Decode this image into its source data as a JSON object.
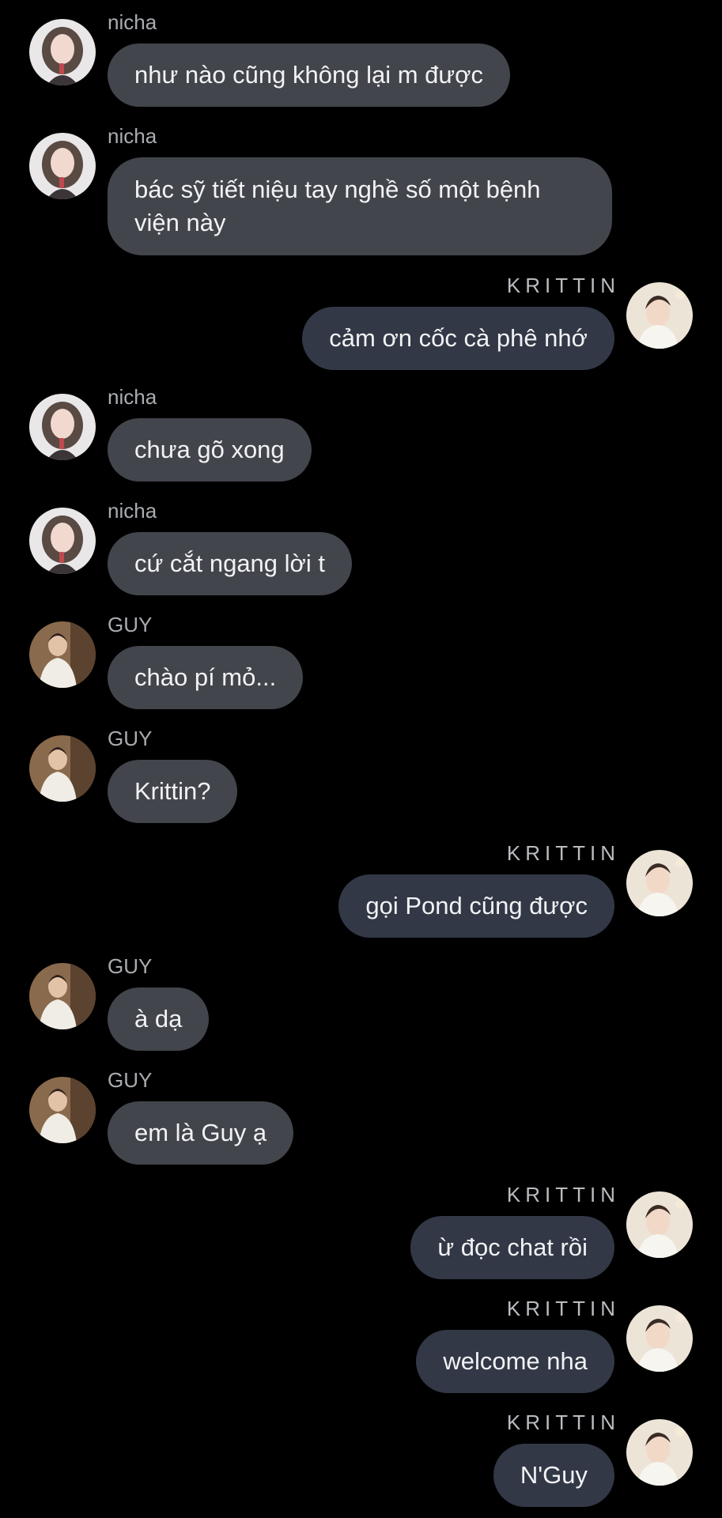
{
  "colors": {
    "background": "#000000",
    "incoming_bubble": "#43454c",
    "outgoing_bubble": "#323846",
    "bubble_text": "#f1f2f4",
    "incoming_name": "#a9acb1",
    "outgoing_name": "#b9bcc1"
  },
  "messages": [
    {
      "sender": "nicha",
      "side": "left",
      "avatar": "nicha-avatar",
      "text": "như nào cũng không lại m được"
    },
    {
      "sender": "nicha",
      "side": "left",
      "avatar": "nicha-avatar",
      "text": "bác sỹ tiết niệu tay nghề số một bệnh viện này"
    },
    {
      "sender": "KRITTIN",
      "side": "right",
      "avatar": "krittin-avatar",
      "text": "cảm ơn cốc cà phê nhớ"
    },
    {
      "sender": "nicha",
      "side": "left",
      "avatar": "nicha-avatar",
      "text": "chưa gõ xong"
    },
    {
      "sender": "nicha",
      "side": "left",
      "avatar": "nicha-avatar",
      "text": "cứ cắt ngang lời t"
    },
    {
      "sender": "GUY",
      "side": "left",
      "avatar": "guy-avatar",
      "text": "chào pí mỏ..."
    },
    {
      "sender": "GUY",
      "side": "left",
      "avatar": "guy-avatar",
      "text": "Krittin?"
    },
    {
      "sender": "KRITTIN",
      "side": "right",
      "avatar": "krittin-avatar",
      "text": "gọi Pond cũng được"
    },
    {
      "sender": "GUY",
      "side": "left",
      "avatar": "guy-avatar",
      "text": "à dạ"
    },
    {
      "sender": "GUY",
      "side": "left",
      "avatar": "guy-avatar",
      "text": "em là Guy ạ"
    },
    {
      "sender": "KRITTIN",
      "side": "right",
      "avatar": "krittin-avatar",
      "text": "ừ đọc chat rồi"
    },
    {
      "sender": "KRITTIN",
      "side": "right",
      "avatar": "krittin-avatar",
      "text": "welcome nha"
    },
    {
      "sender": "KRITTIN",
      "side": "right",
      "avatar": "krittin-avatar",
      "text": "N'Guy"
    }
  ]
}
